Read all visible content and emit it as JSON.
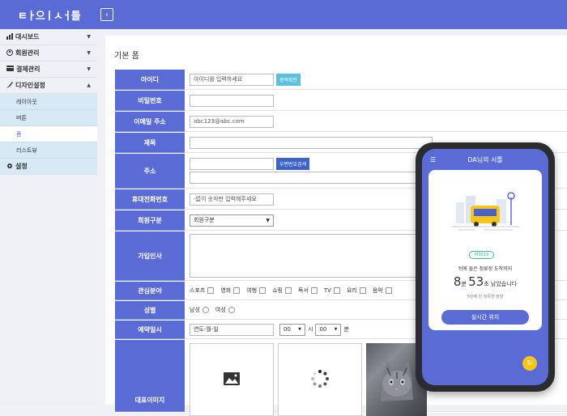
{
  "header": {
    "logo_text": "ㅌㅏ으ㅣㅅㅓ툴",
    "collapse_icon": "chevron-left-icon"
  },
  "sidebar": {
    "items": [
      {
        "label": "대시보드",
        "icon": "chart-icon"
      },
      {
        "label": "회원관리",
        "icon": "user-circle-icon"
      },
      {
        "label": "결제관리",
        "icon": "credit-card-icon"
      },
      {
        "label": "디자인설정",
        "icon": "brush-icon"
      }
    ],
    "sub_items": [
      {
        "label": "레이아웃"
      },
      {
        "label": "버튼"
      },
      {
        "label": "폼"
      },
      {
        "label": "리스트뷰"
      }
    ],
    "settings": {
      "label": "설정",
      "icon": "gear-icon"
    }
  },
  "main": {
    "title": "기본 폼",
    "form": {
      "id_label": "아이디",
      "id_placeholder": "아이디를 입력하세요",
      "id_check": "중복확인",
      "pw_label": "비밀번호",
      "email_label": "이메일 주소",
      "email_value": "abc123@abc.com",
      "subject_label": "제목",
      "address_label": "주소",
      "address_search": "우편번호검색",
      "phone_label": "휴대전화번호",
      "phone_placeholder": "-없이 숫자만 입력해주세요",
      "member_type_label": "회원구분",
      "member_type_value": "회원구분",
      "greeting_label": "가입인사",
      "interest_label": "관심분야",
      "interests": [
        "스포츠",
        "영화",
        "여행",
        "쇼핑",
        "독서",
        "TV",
        "요리",
        "음악"
      ],
      "gender_label": "성별",
      "genders": [
        "남성",
        "여성"
      ],
      "reservation_label": "예약일시",
      "date_placeholder": "연도-월-일",
      "hour_value": "00",
      "hour_unit": "시",
      "minute_value": "00",
      "minute_unit": "분",
      "image_label": "대표이미지"
    }
  },
  "phone": {
    "title": "DA님의 서툴",
    "badge": "M3019",
    "line1": "뒤에 둘은 정류장 도착까지",
    "minutes": "8",
    "minutes_unit": "분",
    "seconds": "53",
    "seconds_unit": "초",
    "remaining": " 남았습니다",
    "line3": "5번째 전 정류장 출발",
    "button": "실시간 위치"
  },
  "colors": {
    "accent": "#5b6bd6",
    "teal": "#5bc0de",
    "blue_btn": "#3d63c9",
    "fab": "#f5c518"
  }
}
